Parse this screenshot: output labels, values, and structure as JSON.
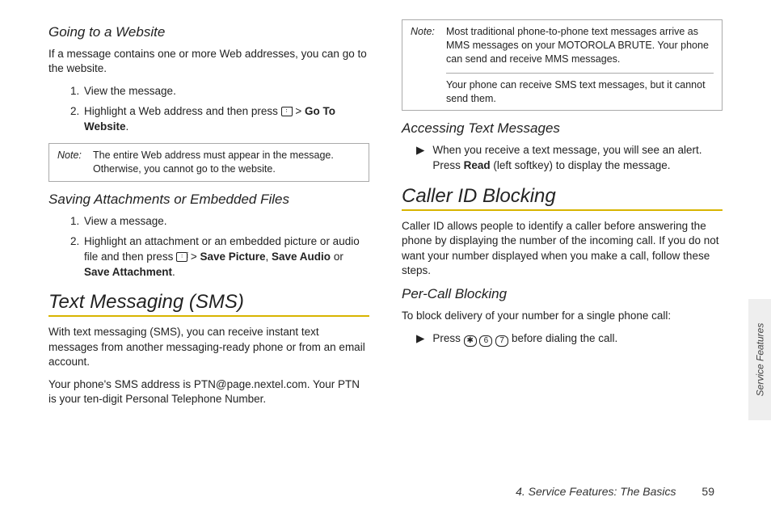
{
  "left": {
    "h3a": "Going to a Website",
    "p1": "If a message contains one or more Web addresses, you can go to the website.",
    "list1": {
      "i1": "View the message.",
      "i2_pre": "Highlight a Web address and then press ",
      "i2_mid": " > ",
      "i2_bold": "Go To Website",
      "i2_end": "."
    },
    "note1": {
      "label": "Note:",
      "text": "The entire Web address must appear in the message. Otherwise, you cannot go to the website."
    },
    "h3b": "Saving Attachments or Embedded Files",
    "list2": {
      "i1": "View a message.",
      "i2_pre": "Highlight an attachment or an embedded picture or audio file and then press ",
      "i2_mid": " > ",
      "i2_b1": "Save Picture",
      "i2_s1": ", ",
      "i2_b2": "Save Audio",
      "i2_s2": " or ",
      "i2_b3": "Save Attachment",
      "i2_end": "."
    },
    "h2": "Text Messaging (SMS)",
    "p2": "With text messaging (SMS), you can receive instant text messages from another messaging-ready phone or from an email account.",
    "p3": "Your phone's SMS address is PTN@page.nextel.com. Your PTN is your ten-digit Personal Telephone Number."
  },
  "right": {
    "note2": {
      "label": "Note:",
      "text1": "Most traditional phone-to-phone text messages arrive as MMS messages on your MOTOROLA BRUTE. Your phone can send and receive MMS messages.",
      "text2": "Your phone can receive SMS text messages, but it cannot send them."
    },
    "h3a": "Accessing Text Messages",
    "bullet1_pre": "When you receive a text message, you will see an alert. Press ",
    "bullet1_bold": "Read",
    "bullet1_post": " (left softkey) to display the message.",
    "h2": "Caller ID Blocking",
    "p1": "Caller ID allows people to identify a caller before answering the phone by displaying the number of the incoming call. If you do not want your number displayed when you make a call, follow these steps.",
    "h3b": "Per-Call Blocking",
    "p2": "To block delivery of your number for a single phone call:",
    "bullet2_pre": "Press ",
    "bullet2_k1": "✱",
    "bullet2_k2": "6",
    "bullet2_k3": "7",
    "bullet2_post": " before dialing the call."
  },
  "sidebar": "Service Features",
  "footer": {
    "title": "4. Service Features: The Basics",
    "page": "59"
  }
}
